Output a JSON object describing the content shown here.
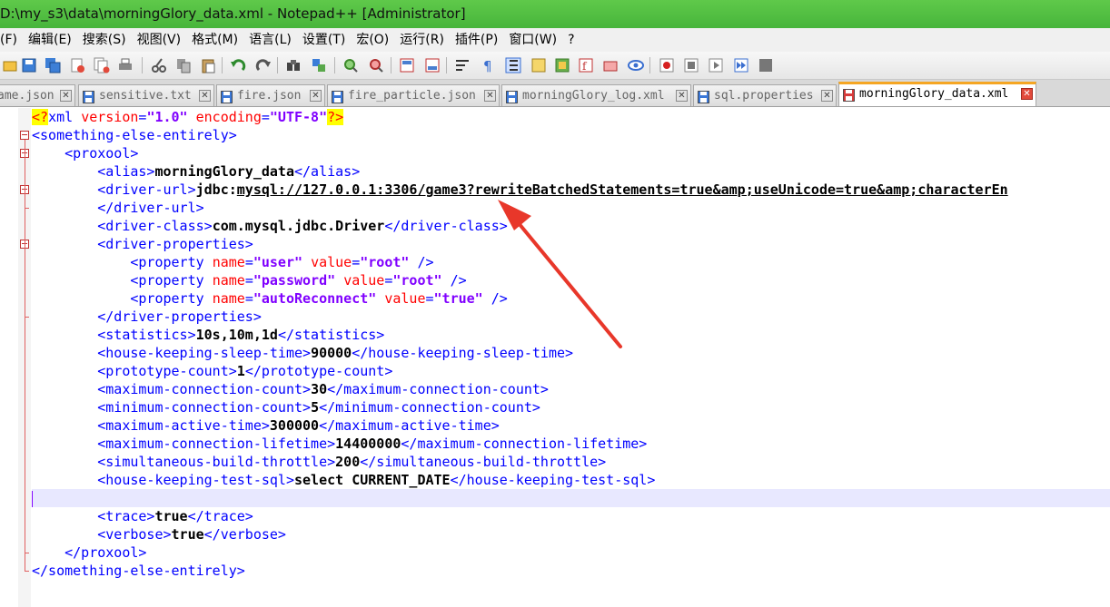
{
  "window": {
    "title": "D:\\my_s3\\data\\morningGlory_data.xml - Notepad++ [Administrator]"
  },
  "menu": [
    "(F)",
    "编辑(E)",
    "搜索(S)",
    "视图(V)",
    "格式(M)",
    "语言(L)",
    "设置(T)",
    "宏(O)",
    "运行(R)",
    "插件(P)",
    "窗口(W)",
    "?"
  ],
  "toolbar_icons": [
    "open-icon",
    "save-icon",
    "save-all-icon",
    "close-icon",
    "close-all-icon",
    "print-icon",
    "cut-icon",
    "copy-icon",
    "paste-icon",
    "undo-icon",
    "redo-icon",
    "find-icon",
    "replace-icon",
    "zoom-in-icon",
    "zoom-out-icon",
    "sync-vertical-icon",
    "sync-horizontal-icon",
    "word-wrap-icon",
    "show-all-chars-icon",
    "indent-guide-icon",
    "udl-icon",
    "doc-map-icon",
    "function-list-icon",
    "folder-workspace-icon",
    "monitor-icon",
    "record-macro-icon",
    "stop-macro-icon",
    "play-macro-icon",
    "run-macro-multiple-icon",
    "save-macro-icon"
  ],
  "tabs": [
    {
      "label": "ame.json",
      "icon": "file-saved-icon",
      "active": false
    },
    {
      "label": "sensitive.txt",
      "icon": "file-saved-icon",
      "active": false
    },
    {
      "label": "fire.json",
      "icon": "file-saved-icon",
      "active": false
    },
    {
      "label": "fire_particle.json",
      "icon": "file-saved-icon",
      "active": false
    },
    {
      "label": "morningGlory_log.xml",
      "icon": "file-saved-icon",
      "active": false
    },
    {
      "label": "sql.properties",
      "icon": "file-saved-icon",
      "active": false
    },
    {
      "label": "morningGlory_data.xml",
      "icon": "file-modified-icon",
      "active": true
    }
  ],
  "editor": {
    "xml_decl": {
      "open": "<?",
      "name": "xml",
      "attr1": "version",
      "val1": "\"1.0\"",
      "attr2": "encoding",
      "val2": "\"UTF-8\"",
      "close": "?>"
    },
    "root_open": "<something-else-entirely>",
    "proxool_open": "<proxool>",
    "alias": {
      "open": "<alias>",
      "text": "morningGlory_data",
      "close": "</alias>"
    },
    "driver_url": {
      "open": "<driver-url>",
      "prefix": "jdbc:",
      "url": "mysql://127.0.0.1:3306/game3?rewriteBatchedStatements=true&amp;useUnicode=true&amp;characterEn",
      "close": "</driver-url>"
    },
    "driver_class": {
      "open": "<driver-class>",
      "text": "com.mysql.jdbc.Driver",
      "close": "</driver-class>"
    },
    "driver_props_open": "<driver-properties>",
    "properties": [
      {
        "name": "\"user\"",
        "value": "\"root\""
      },
      {
        "name": "\"password\"",
        "value": "\"root\""
      },
      {
        "name": "\"autoReconnect\"",
        "value": "\"true\""
      }
    ],
    "property_tag": "<property",
    "property_end": "/>",
    "attr_name": "name",
    "attr_value": "value",
    "driver_props_close": "</driver-properties>",
    "elements": [
      {
        "tag": "statistics",
        "text": "10s,10m,1d"
      },
      {
        "tag": "house-keeping-sleep-time",
        "text": "90000"
      },
      {
        "tag": "prototype-count",
        "text": "1"
      },
      {
        "tag": "maximum-connection-count",
        "text": "30"
      },
      {
        "tag": "minimum-connection-count",
        "text": "5"
      },
      {
        "tag": "maximum-active-time",
        "text": "300000"
      },
      {
        "tag": "maximum-connection-lifetime",
        "text": "14400000"
      },
      {
        "tag": "simultaneous-build-throttle",
        "text": "200"
      },
      {
        "tag": "house-keeping-test-sql",
        "text": "select CURRENT_DATE"
      }
    ],
    "tail_elements": [
      {
        "tag": "trace",
        "text": "true"
      },
      {
        "tag": "verbose",
        "text": "true"
      }
    ],
    "proxool_close": "</proxool>",
    "root_close": "</something-else-entirely>"
  },
  "colors": {
    "tag": "#0000ff",
    "attribute": "#ff0000",
    "string": "#8000ff",
    "title_bar": "#4cbb3f",
    "arrow": "#e8372a"
  }
}
